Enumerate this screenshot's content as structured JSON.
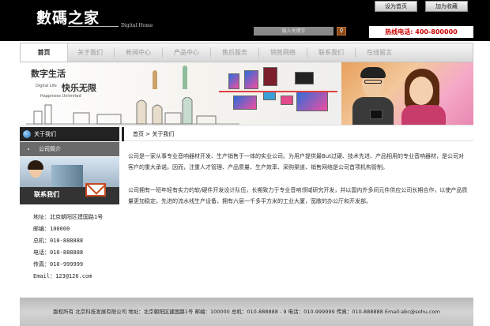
{
  "header": {
    "logo_title": "數碼之家",
    "logo_subtitle": "Digital  Home",
    "set_home_label": "设为首页",
    "add_favorite_label": "加为收藏",
    "search_placeholder": "输入关键字",
    "search_icon": "search-icon",
    "hotline": "热线电话: 400-800000"
  },
  "nav": {
    "items": [
      "首页",
      "关于我们",
      "新闻中心",
      "产品中心",
      "售后服务",
      "销售网络",
      "联系我们",
      "在线留言"
    ],
    "active_index": 0
  },
  "banner": {
    "title_line1": "数字生活",
    "title_line2": "快乐无限",
    "en_line1": "Digital Life",
    "en_line2": "Happiness Unlimited"
  },
  "sidebar": {
    "section_title": "关于我们",
    "sub_items": [
      "公司简介"
    ],
    "contact_title": "联系我们",
    "contact_lines": [
      "地址：北京朝阳区建国路1号",
      "邮编：100000",
      "总机：010-888888",
      "电话：010-888888",
      "传真：010-999999",
      "Email：123@126.com"
    ]
  },
  "main": {
    "breadcrumb": "首页 > 关于我们",
    "paragraphs": [
      "公司是一家从事专业音响器材开发、生产销售于一体的实业公司。为用户提供最But过硬、技术先进、产品相用的专业音响器材，是公司对客户的重大承诺。因而，注重人才管理、产品质量、生产效率、采购渠道、销售网络是公司首项机构管制。",
      "公司拥有一班年轻有实力的软/硬件开发设计队伍，长期致力于专业音响领域研究开发，并以国内外多间元件供应公司长期合作，以使产品质量更加稳定。先进的流水线生产设备，拥有六层一千多平方米的工业大厦，宽敞的办公厅和开发部。"
    ]
  },
  "footer": {
    "text": "版权所有   北京科技发展有限公司 地址：北京朝阳区建国路1号 邮编：100000    总机：010-888888 - 9 电话：010-999999 传真：010-888888 Email:abc@sohu.com"
  }
}
